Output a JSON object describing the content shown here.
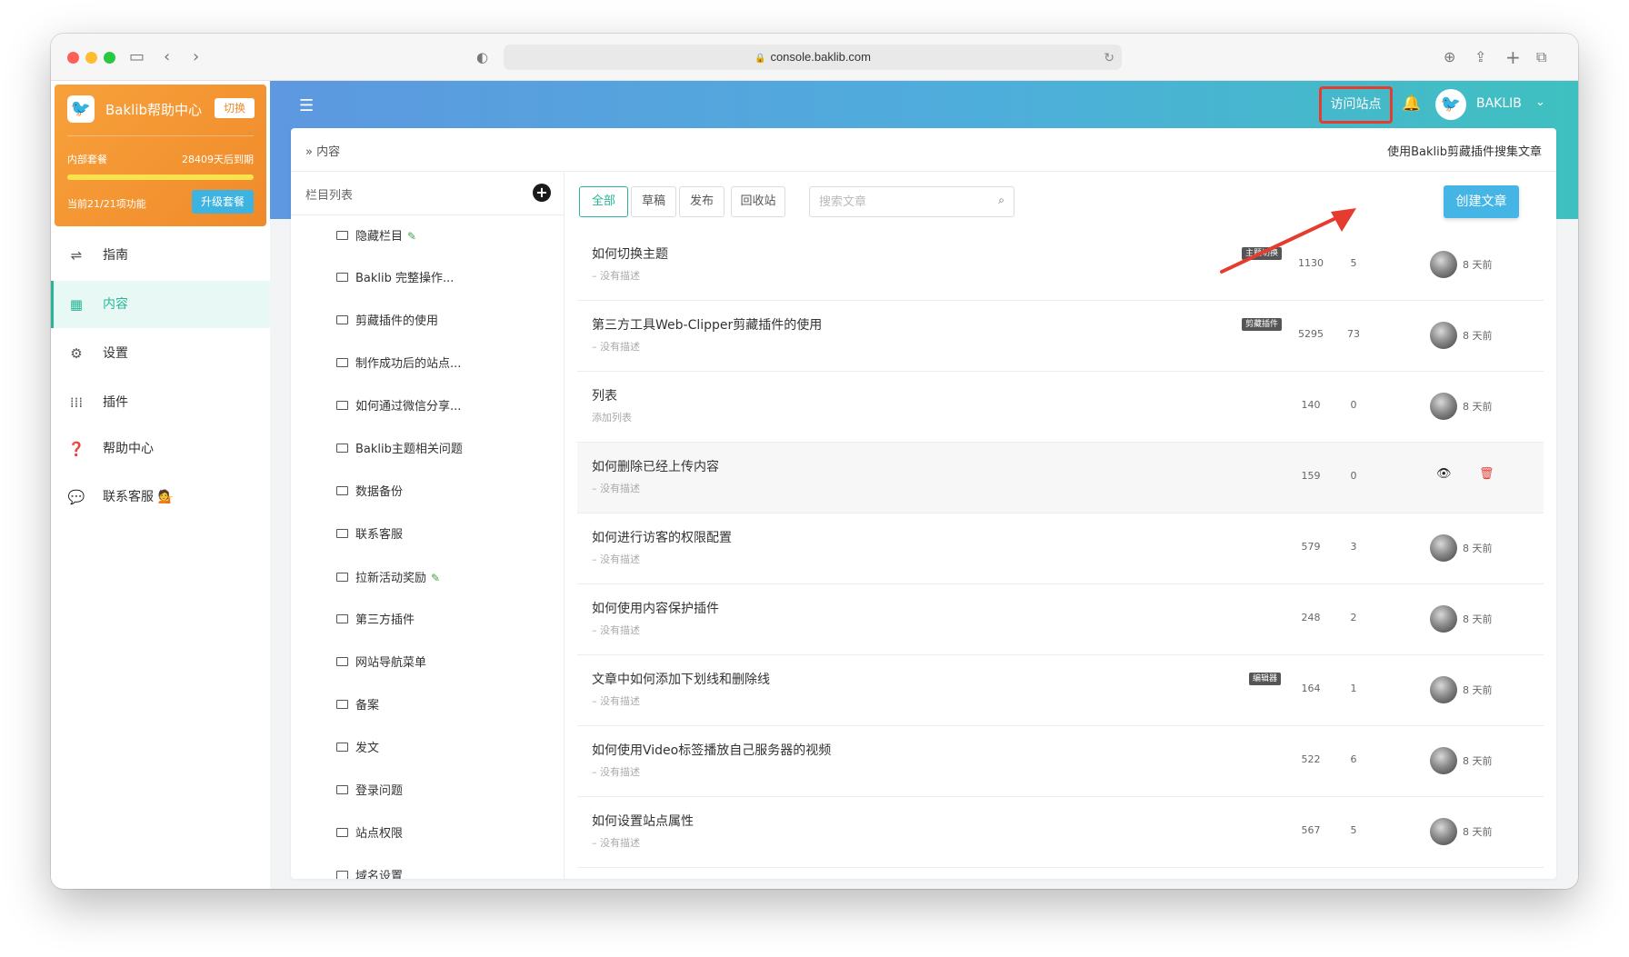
{
  "browser": {
    "url": "console.baklib.com",
    "controls": {
      "sidebar_icon": "sidebar-toggle-icon",
      "back_icon": "chevron-left-icon",
      "forward_icon": "chevron-right-icon"
    }
  },
  "brand": {
    "name": "Baklib帮助中心",
    "switch_label": "切换",
    "plan": "内部套餐",
    "expires": "28409天后到期",
    "quota": "当前21/21项功能",
    "quota_progress": 1.0,
    "upgrade_label": "升级套餐"
  },
  "sidebar": {
    "items": [
      {
        "label": "指南",
        "icon": "sliders-icon"
      },
      {
        "label": "内容",
        "icon": "grid-icon",
        "active": true
      },
      {
        "label": "设置",
        "icon": "gear-icon"
      },
      {
        "label": "插件",
        "icon": "dots-grid-icon"
      },
      {
        "label": "帮助中心",
        "icon": "question-circle-icon"
      },
      {
        "label": "联系客服",
        "icon": "chat-icon",
        "badge": "💁"
      }
    ]
  },
  "header": {
    "visit_site": "访问站点",
    "username": "BAKLIB"
  },
  "breadcrumb": {
    "current": "内容",
    "right_text": "使用Baklib剪藏插件搜集文章"
  },
  "columns": {
    "title": "栏目列表",
    "items": [
      {
        "label": "隐藏栏目",
        "pen": true
      },
      {
        "label": "Baklib 完整操作..."
      },
      {
        "label": "剪藏插件的使用"
      },
      {
        "label": "制作成功后的站点..."
      },
      {
        "label": "如何通过微信分享..."
      },
      {
        "label": "Baklib主题相关问题"
      },
      {
        "label": "数据备份"
      },
      {
        "label": "联系客服"
      },
      {
        "label": "拉新活动奖励",
        "pen": true
      },
      {
        "label": "第三方插件"
      },
      {
        "label": "网站导航菜单"
      },
      {
        "label": "备案"
      },
      {
        "label": "发文"
      },
      {
        "label": "登录问题"
      },
      {
        "label": "站点权限"
      },
      {
        "label": "域名设置"
      }
    ]
  },
  "filters": {
    "tabs": [
      "全部",
      "草稿",
      "发布",
      "回收站"
    ],
    "search_placeholder": "搜索文章",
    "create_label": "创建文章"
  },
  "articles": [
    {
      "title": "如何切换主题",
      "desc": "– 没有描述",
      "tag": "主题切换",
      "views": "1130",
      "likes": "5",
      "time": "8 天前"
    },
    {
      "title": "第三方工具Web-Clipper剪藏插件的使用",
      "desc": "– 没有描述",
      "tag": "剪藏插件",
      "views": "5295",
      "likes": "73",
      "time": "8 天前"
    },
    {
      "title": "列表",
      "desc": "添加列表",
      "tag": "",
      "views": "140",
      "likes": "0",
      "time": "8 天前"
    },
    {
      "title": "如何删除已经上传内容",
      "desc": "– 没有描述",
      "tag": "",
      "views": "159",
      "likes": "0",
      "time": "",
      "hover": true
    },
    {
      "title": "如何进行访客的权限配置",
      "desc": "– 没有描述",
      "tag": "",
      "views": "579",
      "likes": "3",
      "time": "8 天前"
    },
    {
      "title": "如何使用内容保护插件",
      "desc": "– 没有描述",
      "tag": "",
      "views": "248",
      "likes": "2",
      "time": "8 天前"
    },
    {
      "title": "文章中如何添加下划线和删除线",
      "desc": "– 没有描述",
      "tag": "编辑器",
      "views": "164",
      "likes": "1",
      "time": "8 天前"
    },
    {
      "title": "如何使用Video标签播放自己服务器的视频",
      "desc": "– 没有描述",
      "tag": "",
      "views": "522",
      "likes": "6",
      "time": "8 天前"
    },
    {
      "title": "如何设置站点属性",
      "desc": "– 没有描述",
      "tag": "",
      "views": "567",
      "likes": "5",
      "time": "8 天前"
    }
  ],
  "colors": {
    "accent": "#2ab598",
    "brand_orange": "#f08a2a",
    "highlight_red": "#e53c2f",
    "create_blue": "#45b5e5"
  }
}
